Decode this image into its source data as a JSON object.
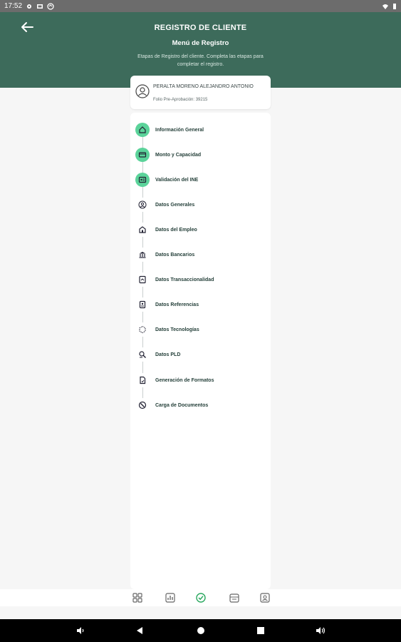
{
  "status_bar": {
    "time": "17:52",
    "icons": [
      "gear-icon",
      "image-icon",
      "sync-icon"
    ],
    "right_icons": [
      "wifi-icon",
      "battery-icon"
    ]
  },
  "header": {
    "title": "REGISTRO DE CLIENTE",
    "subtitle": "Menú de Registro",
    "description": "Etapas de Registro del cliente. Completa las etapas para completar el registro."
  },
  "client": {
    "name": "PERALTA MORENO ALEJANDRO ANTONIO",
    "folio": "Folio Pre-Aprobación: 39215"
  },
  "steps": [
    {
      "label": "Información General",
      "done": true,
      "icon": "house-icon"
    },
    {
      "label": "Monto y Capacidad",
      "done": true,
      "icon": "card-icon"
    },
    {
      "label": "Validación del INE",
      "done": true,
      "icon": "id-card-icon"
    },
    {
      "label": "Datos Generales",
      "done": false,
      "icon": "person-icon"
    },
    {
      "label": "Datos del Empleo",
      "done": false,
      "icon": "office-icon"
    },
    {
      "label": "Datos Bancarios",
      "done": false,
      "icon": "bank-icon"
    },
    {
      "label": "Datos Transaccionalidad",
      "done": false,
      "icon": "transaction-icon"
    },
    {
      "label": "Datos Referencias",
      "done": false,
      "icon": "reference-icon"
    },
    {
      "label": "Datos Tecnologías",
      "done": false,
      "icon": "technology-icon"
    },
    {
      "label": "Datos PLD",
      "done": false,
      "icon": "pld-icon"
    },
    {
      "label": "Generación de Formatos",
      "done": false,
      "icon": "document-icon"
    },
    {
      "label": "Carga de Documentos",
      "done": false,
      "icon": "upload-icon"
    }
  ],
  "bottom_nav": [
    "grid-icon",
    "report-icon",
    "check-active-icon",
    "calendar-icon",
    "contacts-icon"
  ],
  "colors": {
    "header": "#3d6b5b",
    "done": "#5bd39a",
    "accent": "#2aa85f"
  }
}
